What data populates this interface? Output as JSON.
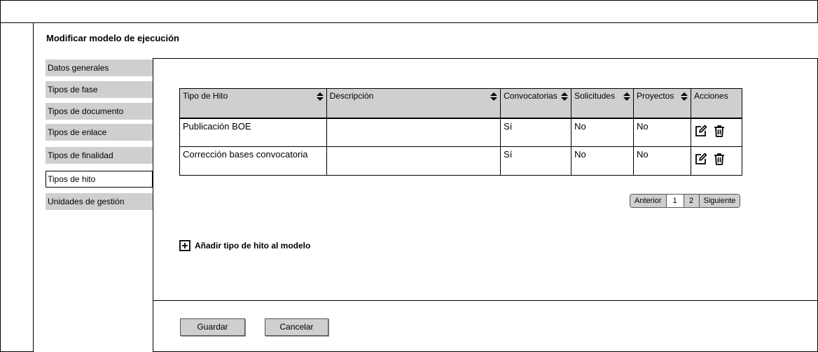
{
  "page": {
    "title": "Modificar modelo de ejecución"
  },
  "nav": {
    "items": [
      {
        "label": "Datos generales",
        "active": false
      },
      {
        "label": "Tipos de fase",
        "active": false
      },
      {
        "label": "Tipos de documento",
        "active": false
      },
      {
        "label": "Tipos de enlace",
        "active": false
      },
      {
        "label": "Tipos de finalidad",
        "active": false
      },
      {
        "label": "Tipos de hito",
        "active": true
      },
      {
        "label": "Unidades de gestión",
        "active": false
      }
    ]
  },
  "table": {
    "columns": [
      "Tipo de Hito",
      "Descripción",
      "Convocatorias",
      "Solicitudes",
      "Proyectos",
      "Acciones"
    ],
    "rows": [
      {
        "tipo": "Publicación BOE",
        "descripcion": "",
        "convocatorias": "Sí",
        "solicitudes": "No",
        "proyectos": "No",
        "actions": [
          "edit-icon",
          "trash-icon"
        ]
      },
      {
        "tipo": "Corrección bases convocatoria",
        "descripcion": "",
        "convocatorias": "Sí",
        "solicitudes": "No",
        "proyectos": "No",
        "actions": [
          "edit-icon",
          "trash-icon"
        ]
      }
    ]
  },
  "pagination": {
    "prev": "Anterior",
    "pages": [
      "1",
      "2"
    ],
    "current": "1",
    "next": "Siguiente"
  },
  "add_action": {
    "label": "Añadir tipo de hito al modelo",
    "icon": "plus-square-icon"
  },
  "footer": {
    "save_label": "Guardar",
    "cancel_label": "Cancelar"
  }
}
